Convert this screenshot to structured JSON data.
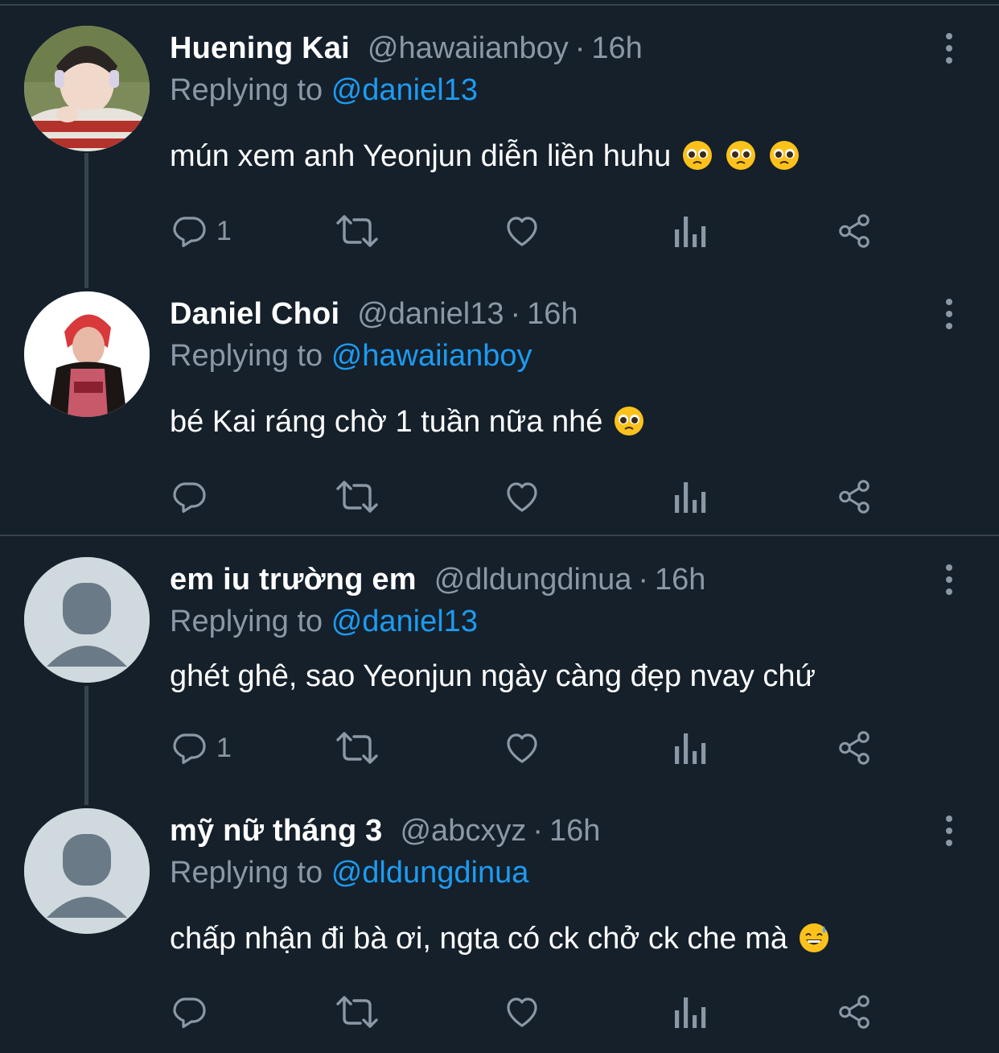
{
  "colors": {
    "background": "#15202b",
    "divider": "#38444d",
    "secondary_text": "#8b98a5",
    "mention": "#1d9bf0",
    "primary_text": "#ffffff"
  },
  "icons": {
    "reply": "reply-icon",
    "retweet": "retweet-icon",
    "like": "heart-icon",
    "views": "analytics-icon",
    "share": "share-icon",
    "more": "more-vertical-icon"
  },
  "tweets": [
    {
      "name": "Huening Kai",
      "handle": "@hawaiianboy",
      "separator": "·",
      "time": "16h",
      "replying_prefix": "Replying to",
      "replying_to": "@daniel13",
      "text": "mún xem anh Yeonjun diễn liền huhu",
      "emojis": [
        "pleading-face",
        "pleading-face",
        "pleading-face"
      ],
      "reply_count": "1",
      "avatar": "photo"
    },
    {
      "name": "Daniel Choi",
      "handle": "@daniel13",
      "separator": "·",
      "time": "16h",
      "replying_prefix": "Replying to",
      "replying_to": "@hawaiianboy",
      "text": "bé Kai ráng chờ 1 tuần nữa nhé",
      "emojis": [
        "pleading-face"
      ],
      "reply_count": "",
      "avatar": "photo"
    },
    {
      "name": "em iu trường em",
      "handle": "@dldungdinua",
      "separator": "·",
      "time": "16h",
      "replying_prefix": "Replying to",
      "replying_to": "@daniel13",
      "text": "ghét ghê, sao Yeonjun ngày càng đẹp nvay chứ",
      "emojis": [],
      "reply_count": "1",
      "avatar": "default"
    },
    {
      "name": "mỹ nữ tháng 3",
      "handle": "@abcxyz",
      "separator": "·",
      "time": "16h",
      "replying_prefix": "Replying to",
      "replying_to": "@dldungdinua",
      "text": "chấp nhận đi bà ơi, ngta có ck chở ck che mà",
      "emojis": [
        "grinning-face-with-sweat"
      ],
      "reply_count": "",
      "avatar": "default"
    }
  ]
}
